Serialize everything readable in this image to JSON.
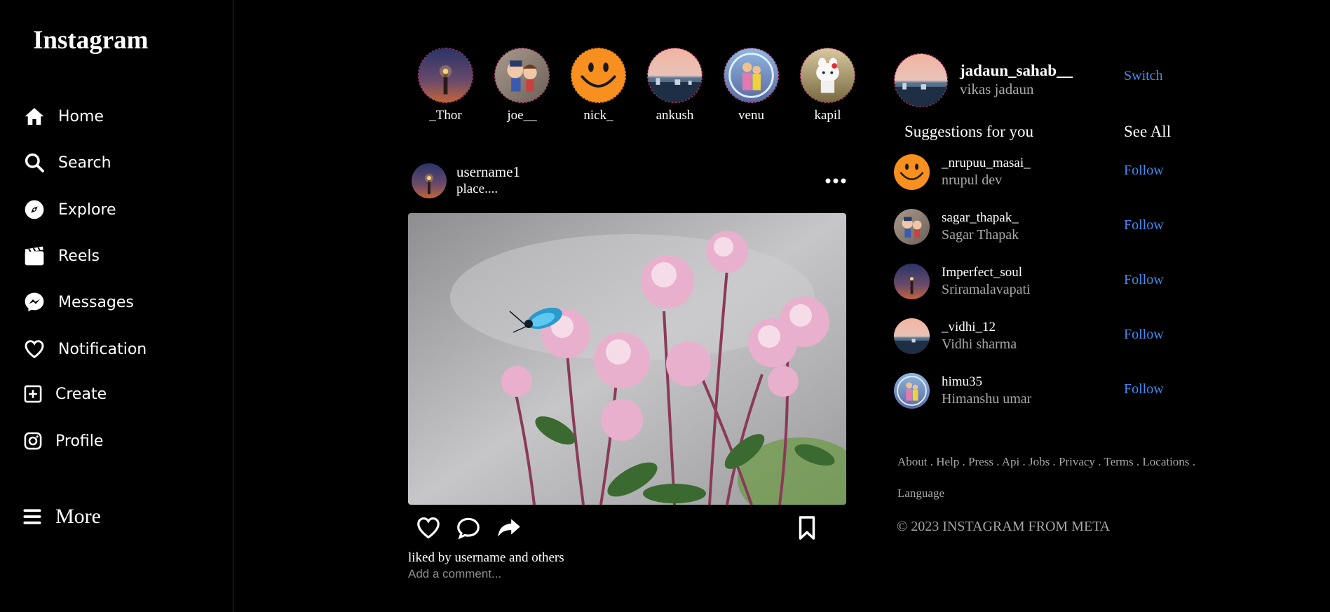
{
  "logo": "Instagram",
  "nav": [
    {
      "label": "Home",
      "icon": "home-icon"
    },
    {
      "label": "Search",
      "icon": "search-icon"
    },
    {
      "label": "Explore",
      "icon": "compass-icon"
    },
    {
      "label": "Reels",
      "icon": "reels-icon"
    },
    {
      "label": "Messages",
      "icon": "messenger-icon"
    },
    {
      "label": "Notification",
      "icon": "heart-icon"
    },
    {
      "label": "Create",
      "icon": "plus-square-icon"
    },
    {
      "label": "Profile",
      "icon": "instagram-icon"
    }
  ],
  "more_label": "More",
  "stories": [
    {
      "name": "_Thor"
    },
    {
      "name": "joe__"
    },
    {
      "name": "nick_"
    },
    {
      "name": "ankush"
    },
    {
      "name": "venu"
    },
    {
      "name": "kapil"
    }
  ],
  "post": {
    "username": "username1",
    "place": "place....",
    "liked_by": "liked by username and  others",
    "comment_placeholder": "Add a comment..."
  },
  "current_user": {
    "username": "jadaun_sahab__",
    "name": "vikas jadaun",
    "switch_label": "Switch"
  },
  "suggestions": {
    "title": "Suggestions for you",
    "see_all": "See All",
    "follow_label": "Follow",
    "items": [
      {
        "username": "_nrupuu_masai_",
        "name": "nrupul dev"
      },
      {
        "username": "sagar_thapak_",
        "name": "Sagar Thapak"
      },
      {
        "username": "Imperfect_soul",
        "name": "Sriramalavapati"
      },
      {
        "username": "_vidhi_12",
        "name": "Vidhi sharma"
      },
      {
        "username": "himu35",
        "name": "Himanshu umar"
      }
    ]
  },
  "footer": {
    "links": [
      "About",
      "Help",
      "Press",
      "Api",
      "Jobs",
      "Privacy",
      "Terms",
      "Locations",
      "Language"
    ],
    "copyright": "© 2023 INSTAGRAM FROM META"
  },
  "colors": {
    "background": "#000000",
    "link_blue": "#3d8ef7",
    "muted": "#a8a8a8",
    "story_ring": "#d63a8c"
  }
}
